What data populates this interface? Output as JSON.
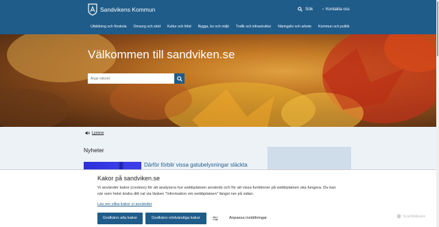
{
  "header": {
    "site_name": "Sandvikens Kommun",
    "search_label": "Sök",
    "contact_label": "Kontakta oss"
  },
  "nav": {
    "items": [
      "Utbildning och förskola",
      "Omsorg och stöd",
      "Kultur och fritid",
      "Bygga, bo och miljö",
      "Trafik och infrastruktur",
      "Näringsliv och arbete",
      "Kommun och politik"
    ]
  },
  "hero": {
    "title": "Välkommen till sandviken.se",
    "search_placeholder": "Ange sökord"
  },
  "content": {
    "listen_label": "Lyssna",
    "news_heading": "Nyheter",
    "news_link": "Därför förblir vissa gatubelysningar släckta"
  },
  "cookie": {
    "title": "Kakor på sandviken.se",
    "text": "Vi använder kakor (cookies) för att analysera hur webbplatsen används och för att vissa funktioner på webbplatsen ska fungera. Du kan när som helst ändra ditt val via länken \"Information om webbplatsen\" längst ner på sidan.",
    "read_more": "Läs om vilka kakor vi använder",
    "accept_all": "Godkänn alla kakor",
    "accept_needed": "Godkänn nödvändiga kakor",
    "customize": "Anpassa inställningar"
  },
  "watermark": "ScanMalware",
  "colors": {
    "brand": "#1f5c8a",
    "band": "#edf2f7"
  }
}
